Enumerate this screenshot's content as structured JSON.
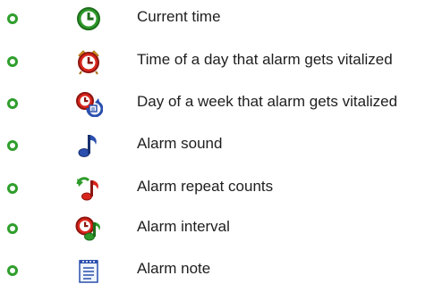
{
  "legend": {
    "items": [
      {
        "icon": "clock-icon",
        "label": "Current time"
      },
      {
        "icon": "alarm-clock-icon",
        "label": "Time of a day that alarm gets vitalized"
      },
      {
        "icon": "calendar-cycle-icon",
        "label": "Day of a week that alarm gets vitalized"
      },
      {
        "icon": "music-note-icon",
        "label": "Alarm sound"
      },
      {
        "icon": "repeat-note-icon",
        "label": "Alarm repeat counts"
      },
      {
        "icon": "interval-clock-icon",
        "label": "Alarm interval"
      },
      {
        "icon": "note-pad-icon",
        "label": "Alarm note"
      }
    ]
  },
  "colors": {
    "bullet": "#2f9e2c",
    "green": "#2e9a2a",
    "red": "#d8261c",
    "blue": "#2a4fae",
    "text": "#1e1e1e"
  }
}
